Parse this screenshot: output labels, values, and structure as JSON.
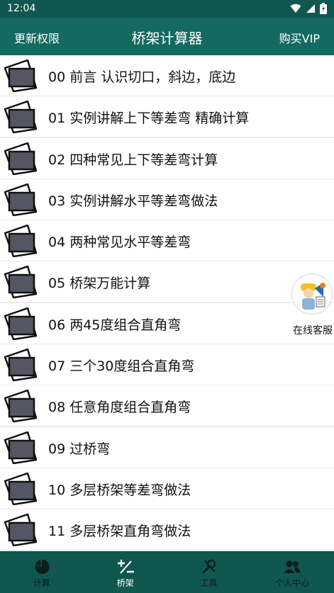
{
  "status": {
    "time": "12:04"
  },
  "header": {
    "left_label": "更新权限",
    "title": "桥架计算器",
    "right_label": "购买VIP"
  },
  "list": {
    "items": [
      {
        "label": "00 前言 认识切口，斜边，底边"
      },
      {
        "label": "01 实例讲解上下等差弯 精确计算"
      },
      {
        "label": "02 四种常见上下等差弯计算"
      },
      {
        "label": "03 实例讲解水平等差弯做法"
      },
      {
        "label": "04 两种常见水平等差弯"
      },
      {
        "label": "05 桥架万能计算"
      },
      {
        "label": "06 两45度组合直角弯"
      },
      {
        "label": "07 三个30度组合直角弯"
      },
      {
        "label": "08 任意角度组合直角弯"
      },
      {
        "label": "09 过桥弯"
      },
      {
        "label": "10 多层桥架等差弯做法"
      },
      {
        "label": "11 多层桥架直角弯做法"
      }
    ]
  },
  "service": {
    "label": "在线客服"
  },
  "nav": {
    "items": [
      {
        "label": "计算",
        "icon": "pie-chart-icon"
      },
      {
        "label": "桥架",
        "icon": "plus-minus-icon"
      },
      {
        "label": "工具",
        "icon": "tools-icon"
      },
      {
        "label": "个人中心",
        "icon": "people-icon"
      }
    ],
    "active_index": 1
  },
  "colors": {
    "status_bar": "#10574f",
    "app_bar": "#146a60",
    "bottom_nav": "#10574f",
    "background": "#ececec",
    "thumb_fill": "#545763"
  }
}
